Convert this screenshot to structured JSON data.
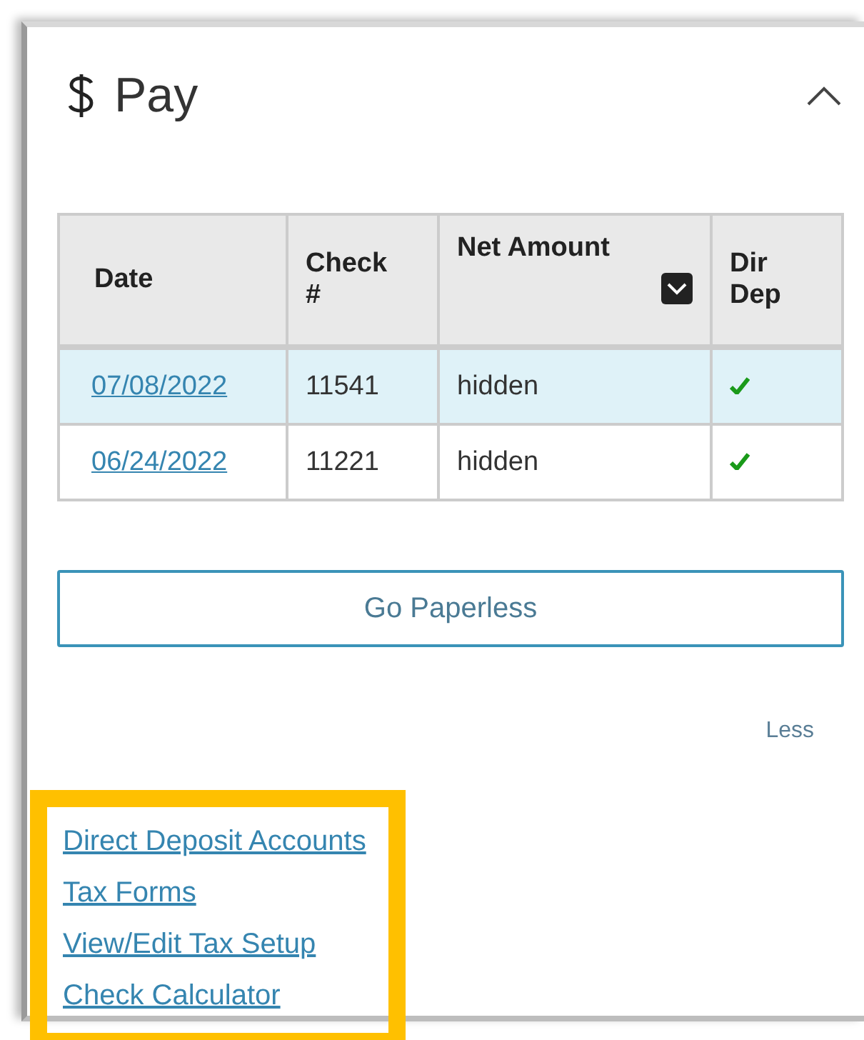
{
  "panel": {
    "title": "Pay",
    "expanded": true
  },
  "table": {
    "columns": [
      {
        "label": "Date",
        "sortable": false
      },
      {
        "label": "Check #",
        "sortable": false
      },
      {
        "label": "Net Amount",
        "sortable": true
      },
      {
        "label": "Dir Dep",
        "sortable": false
      }
    ],
    "rows": [
      {
        "date": "07/08/2022",
        "check": "11541",
        "net_amount": "hidden",
        "direct_deposit": true,
        "selected": true
      },
      {
        "date": "06/24/2022",
        "check": "11221",
        "net_amount": "hidden",
        "direct_deposit": true,
        "selected": false
      }
    ]
  },
  "button": "Go Paperless",
  "toggle": "Less",
  "links": {
    "highlighted": true,
    "items": [
      "Direct Deposit Accounts",
      "Tax Forms",
      "View/Edit Tax Setup",
      "Check Calculator"
    ]
  }
}
